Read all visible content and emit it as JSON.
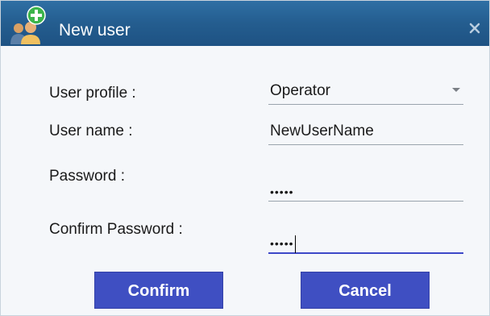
{
  "window": {
    "title": "New user",
    "icons": {
      "title": "add-user-icon",
      "close": "close-icon"
    }
  },
  "form": {
    "user_profile": {
      "label": "User profile :",
      "value": "Operator"
    },
    "user_name": {
      "label": "User name :",
      "value": "NewUserName"
    },
    "password": {
      "label": "Password :",
      "value": "•••••"
    },
    "confirm_password": {
      "label": "Confirm Password :",
      "value": "•••••"
    }
  },
  "buttons": {
    "confirm": "Confirm",
    "cancel": "Cancel"
  },
  "colors": {
    "titlebar": "#245d8f",
    "button": "#3f4fc2",
    "active_underline": "#3d48c8"
  }
}
